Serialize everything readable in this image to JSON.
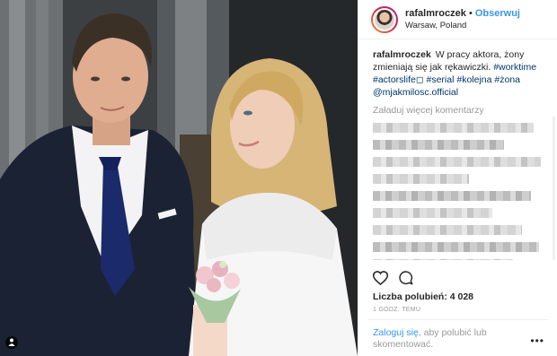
{
  "post": {
    "username": "rafalmroczek",
    "separator": "•",
    "follow_label": "Obserwuj",
    "location": "Warsaw, Poland",
    "caption_text": "W pracy aktora, żony zmieniają się jak rękawiczki.",
    "hashtags": [
      "#worktime",
      "#actorslife◻",
      "#serial",
      "#kolejna",
      "#żona"
    ],
    "mention": "@mjakmilosc.official",
    "load_more": "Załaduj więcej komentarzy",
    "likes": "Liczba polubień: 4 028",
    "time_ago": "1 GODZ. TEMU",
    "login_link": "Zaloguj się",
    "login_text": ", aby polubić lub skomentować.",
    "more_icon": "•••"
  },
  "icons": {
    "like": "heart-icon",
    "comment": "comment-icon",
    "user_tag": "user-icon"
  }
}
